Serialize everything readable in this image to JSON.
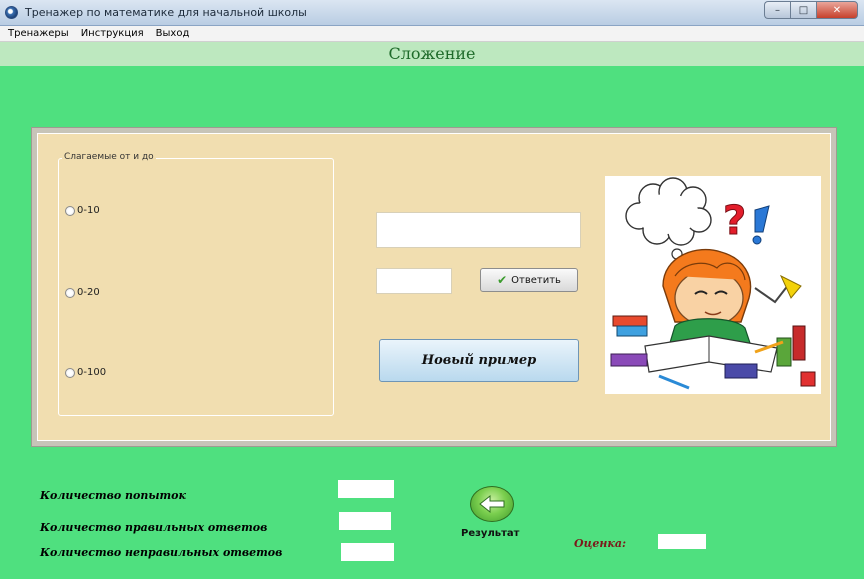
{
  "window": {
    "title": "Тренажер по математике для начальной школы"
  },
  "menu": {
    "items": [
      "Тренажеры",
      "Инструкция",
      "Выход"
    ]
  },
  "header": {
    "title": "Сложение"
  },
  "range_group": {
    "legend": "Слагаемые от и до",
    "options": [
      "0-10",
      "0-20",
      "0-100"
    ]
  },
  "answer": {
    "button_label": "Ответить"
  },
  "new_example": {
    "button_label": "Новый пример"
  },
  "stats": {
    "attempts_label": "Количество попыток",
    "correct_label": "Количество правильных ответов",
    "incorrect_label": "Количество неправильных ответов",
    "result_label": "Результат",
    "grade_label": "Оценка:"
  },
  "colors": {
    "background": "#4fe07f",
    "panel": "#f1deb0",
    "header_strip": "#bde8bf"
  }
}
